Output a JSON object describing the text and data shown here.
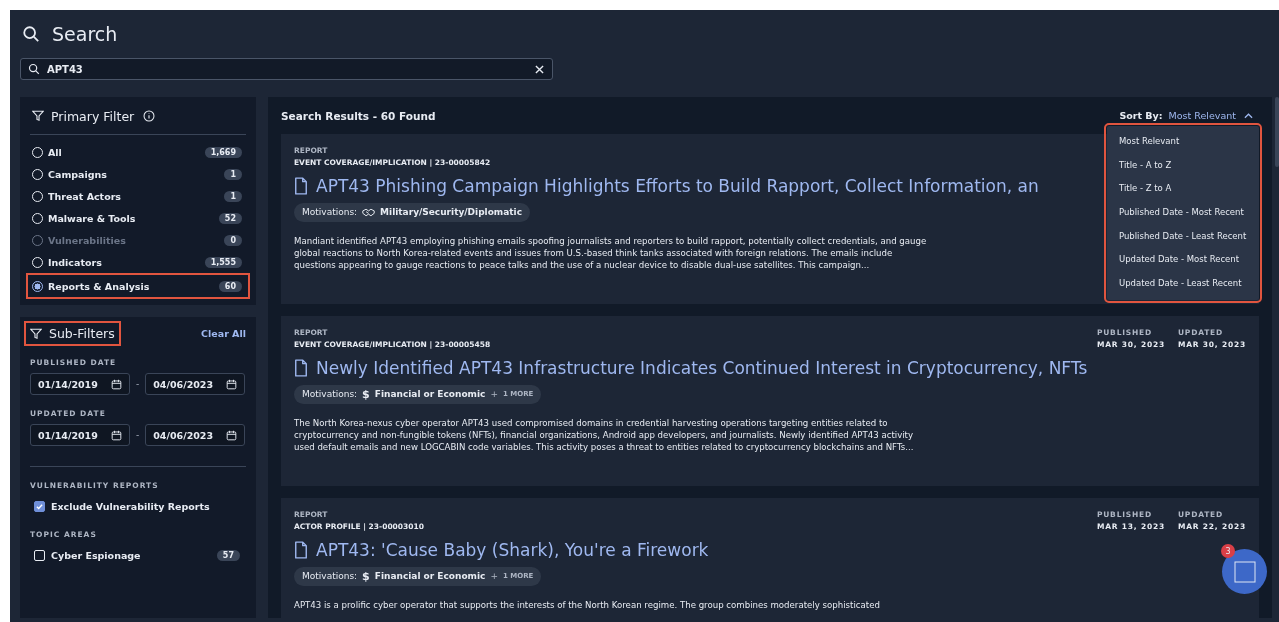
{
  "page_title": "Search",
  "search": {
    "value": "APT43"
  },
  "primary_filter": {
    "title": "Primary Filter",
    "items": [
      {
        "label": "All",
        "count": "1,669",
        "selected": false,
        "disabled": false,
        "highlighted": false
      },
      {
        "label": "Campaigns",
        "count": "1",
        "selected": false,
        "disabled": false,
        "highlighted": false
      },
      {
        "label": "Threat Actors",
        "count": "1",
        "selected": false,
        "disabled": false,
        "highlighted": false
      },
      {
        "label": "Malware & Tools",
        "count": "52",
        "selected": false,
        "disabled": false,
        "highlighted": false
      },
      {
        "label": "Vulnerabilities",
        "count": "0",
        "selected": false,
        "disabled": true,
        "highlighted": false
      },
      {
        "label": "Indicators",
        "count": "1,555",
        "selected": false,
        "disabled": false,
        "highlighted": false
      },
      {
        "label": "Reports & Analysis",
        "count": "60",
        "selected": true,
        "disabled": false,
        "highlighted": true
      }
    ]
  },
  "sub_filters": {
    "title": "Sub-Filters",
    "highlighted": true,
    "clear": "Clear All",
    "date_ranges": [
      {
        "label": "PUBLISHED DATE",
        "from": "01/14/2019",
        "separator": "-",
        "to": "04/06/2023"
      },
      {
        "label": "UPDATED DATE",
        "from": "01/14/2019",
        "separator": "-",
        "to": "04/06/2023"
      }
    ],
    "sections": [
      {
        "label": "VULNERABILITY REPORTS",
        "options": [
          {
            "label": "Exclude Vulnerability Reports",
            "checked": true
          }
        ]
      },
      {
        "label": "TOPIC AREAS",
        "options": [
          {
            "label": "Cyber Espionage",
            "count": "57",
            "checked": false
          }
        ]
      }
    ]
  },
  "results": {
    "title": "Search Results - 60 Found",
    "sort_label": "Sort By:",
    "sort_value": "Most Relevant",
    "sort_menu": {
      "expanded": true,
      "highlighted": true,
      "options": [
        "Most Relevant",
        "Title - A to Z",
        "Title - Z to A",
        "Published Date - Most Recent",
        "Published Date - Least Recent",
        "Updated Date - Most Recent",
        "Updated Date - Least Recent"
      ]
    },
    "cards": [
      {
        "type": "REPORT",
        "meta": "EVENT COVERAGE/IMPLICATION | 23-00005842",
        "title": "APT43 Phishing Campaign Highlights Efforts to Build Rapport, Collect Information, an",
        "motivation_label": "Motivations:",
        "motivation": "Military/Security/Diplomatic",
        "summary": "Mandiant identified APT43 employing phishing emails spoofing journalists and reporters to build rapport, potentially collect credentials, and gauge global reactions to North Korea-related events and issues from U.S.-based think tanks associated with foreign relations. The emails include questions appearing to gauge reactions to peace talks and the use of a nuclear device to disable dual-use satellites. This campaign..."
      },
      {
        "type": "REPORT",
        "meta": "EVENT COVERAGE/IMPLICATION | 23-00005458",
        "published_label": "PUBLISHED",
        "published": "MAR 30, 2023",
        "updated_label": "UPDATED",
        "updated": "MAR 30, 2023",
        "title": "Newly Identified APT43 Infrastructure Indicates Continued Interest in Cryptocurrency, NFTs",
        "motivation_label": "Motivations:",
        "motivation_symbol": "$",
        "motivation": "Financial or Economic",
        "more": "+",
        "more_label": "1 MORE",
        "summary": "The North Korea-nexus cyber operator APT43 used compromised domains in credential harvesting operations targeting entities related to cryptocurrency and non-fungible tokens (NFTs), financial organizations, Android app developers, and journalists. Newly identified APT43 activity used default emails and new LOGCABIN code variables. This activity poses a threat to entities related to cryptocurrency blockchains and NFTs..."
      },
      {
        "type": "REPORT",
        "meta": "ACTOR PROFILE | 23-00003010",
        "published_label": "PUBLISHED",
        "published": "MAR 13, 2023",
        "updated_label": "UPDATED",
        "updated": "MAR 22, 2023",
        "title": "APT43: 'Cause Baby (Shark), You're a Firework",
        "motivation_label": "Motivations:",
        "motivation_symbol": "$",
        "motivation": "Financial or Economic",
        "more": "+",
        "more_label": "1 MORE",
        "summary": "APT43 is a prolific cyber operator that supports the interests of the North Korean regime. The group combines moderately sophisticated"
      }
    ]
  },
  "chat": {
    "badge": "3"
  }
}
